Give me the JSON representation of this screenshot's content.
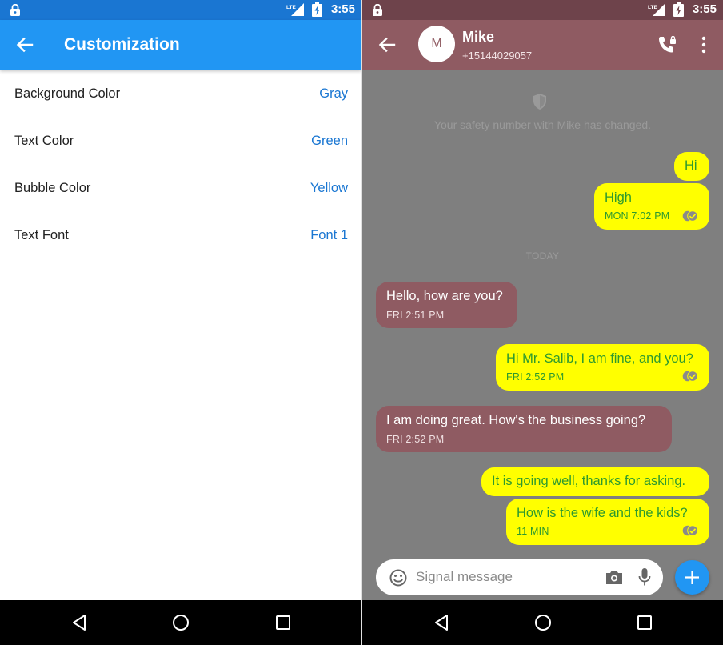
{
  "status_bar": {
    "time": "3:55",
    "network": "LTE"
  },
  "customization": {
    "title": "Customization",
    "settings": [
      {
        "label": "Background Color",
        "value": "Gray"
      },
      {
        "label": "Text Color",
        "value": "Green"
      },
      {
        "label": "Bubble Color",
        "value": "Yellow"
      },
      {
        "label": "Text Font",
        "value": "Font 1"
      }
    ]
  },
  "conversation": {
    "contact": {
      "initial": "M",
      "name": "Mike",
      "number": "+15144029057"
    },
    "safety_notice": "Your safety number with Mike has changed.",
    "date_separator": "TODAY",
    "messages": [
      {
        "direction": "outgoing",
        "text": "Hi",
        "meta": ""
      },
      {
        "direction": "outgoing",
        "text": "High",
        "meta": "MON 7:02 PM"
      },
      {
        "direction": "incoming",
        "text": "Hello, how are you?",
        "meta": "FRI 2:51 PM"
      },
      {
        "direction": "outgoing",
        "text": "Hi Mr. Salib, I am fine, and you?",
        "meta": "FRI 2:52 PM"
      },
      {
        "direction": "incoming",
        "text": "I am doing great. How's the business going?",
        "meta": "FRI 2:52 PM"
      },
      {
        "direction": "outgoing",
        "text": "It is going well, thanks for asking.",
        "meta": ""
      },
      {
        "direction": "outgoing",
        "text": "How is the wife and the kids?",
        "meta": "11 MIN"
      }
    ],
    "composer": {
      "placeholder": "Signal message"
    }
  },
  "colors": {
    "customization_status_bar": "#1a76d2",
    "customization_app_bar": "#2196f3",
    "setting_value": "#1976d2",
    "chat_status_bar": "#6e434b",
    "chat_app_bar": "#8f5b62",
    "chat_background": "#7f7f7f",
    "outgoing_bubble": "#ffff00",
    "outgoing_text": "#2e9a2e",
    "incoming_bubble": "#8f5b62",
    "send_button": "#2196f3"
  }
}
